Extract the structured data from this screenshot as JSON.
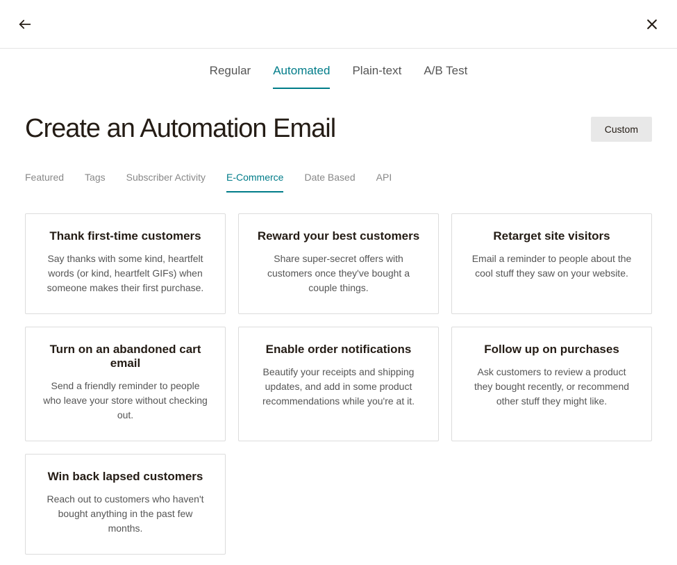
{
  "header": {
    "back_icon": "arrow-left",
    "close_icon": "close"
  },
  "main_tabs": [
    {
      "label": "Regular",
      "active": false
    },
    {
      "label": "Automated",
      "active": true
    },
    {
      "label": "Plain-text",
      "active": false
    },
    {
      "label": "A/B Test",
      "active": false
    }
  ],
  "page": {
    "title": "Create an Automation Email",
    "custom_button": "Custom"
  },
  "sub_tabs": [
    {
      "label": "Featured",
      "active": false
    },
    {
      "label": "Tags",
      "active": false
    },
    {
      "label": "Subscriber Activity",
      "active": false
    },
    {
      "label": "E-Commerce",
      "active": true
    },
    {
      "label": "Date Based",
      "active": false
    },
    {
      "label": "API",
      "active": false
    }
  ],
  "cards": [
    {
      "title": "Thank first-time customers",
      "desc": "Say thanks with some kind, heartfelt words (or kind, heartfelt GIFs) when someone makes their first purchase."
    },
    {
      "title": "Reward your best customers",
      "desc": "Share super-secret offers with customers once they've bought a couple things."
    },
    {
      "title": "Retarget site visitors",
      "desc": "Email a reminder to people about the cool stuff they saw on your website."
    },
    {
      "title": "Turn on an abandoned cart email",
      "desc": "Send a friendly reminder to people who leave your store without checking out."
    },
    {
      "title": "Enable order notifications",
      "desc": "Beautify your receipts and shipping updates, and add in some product recommendations while you're at it."
    },
    {
      "title": "Follow up on purchases",
      "desc": "Ask customers to review a product they bought recently, or recommend other stuff they might like."
    },
    {
      "title": "Win back lapsed customers",
      "desc": "Reach out to customers who haven't bought anything in the past few months."
    }
  ]
}
